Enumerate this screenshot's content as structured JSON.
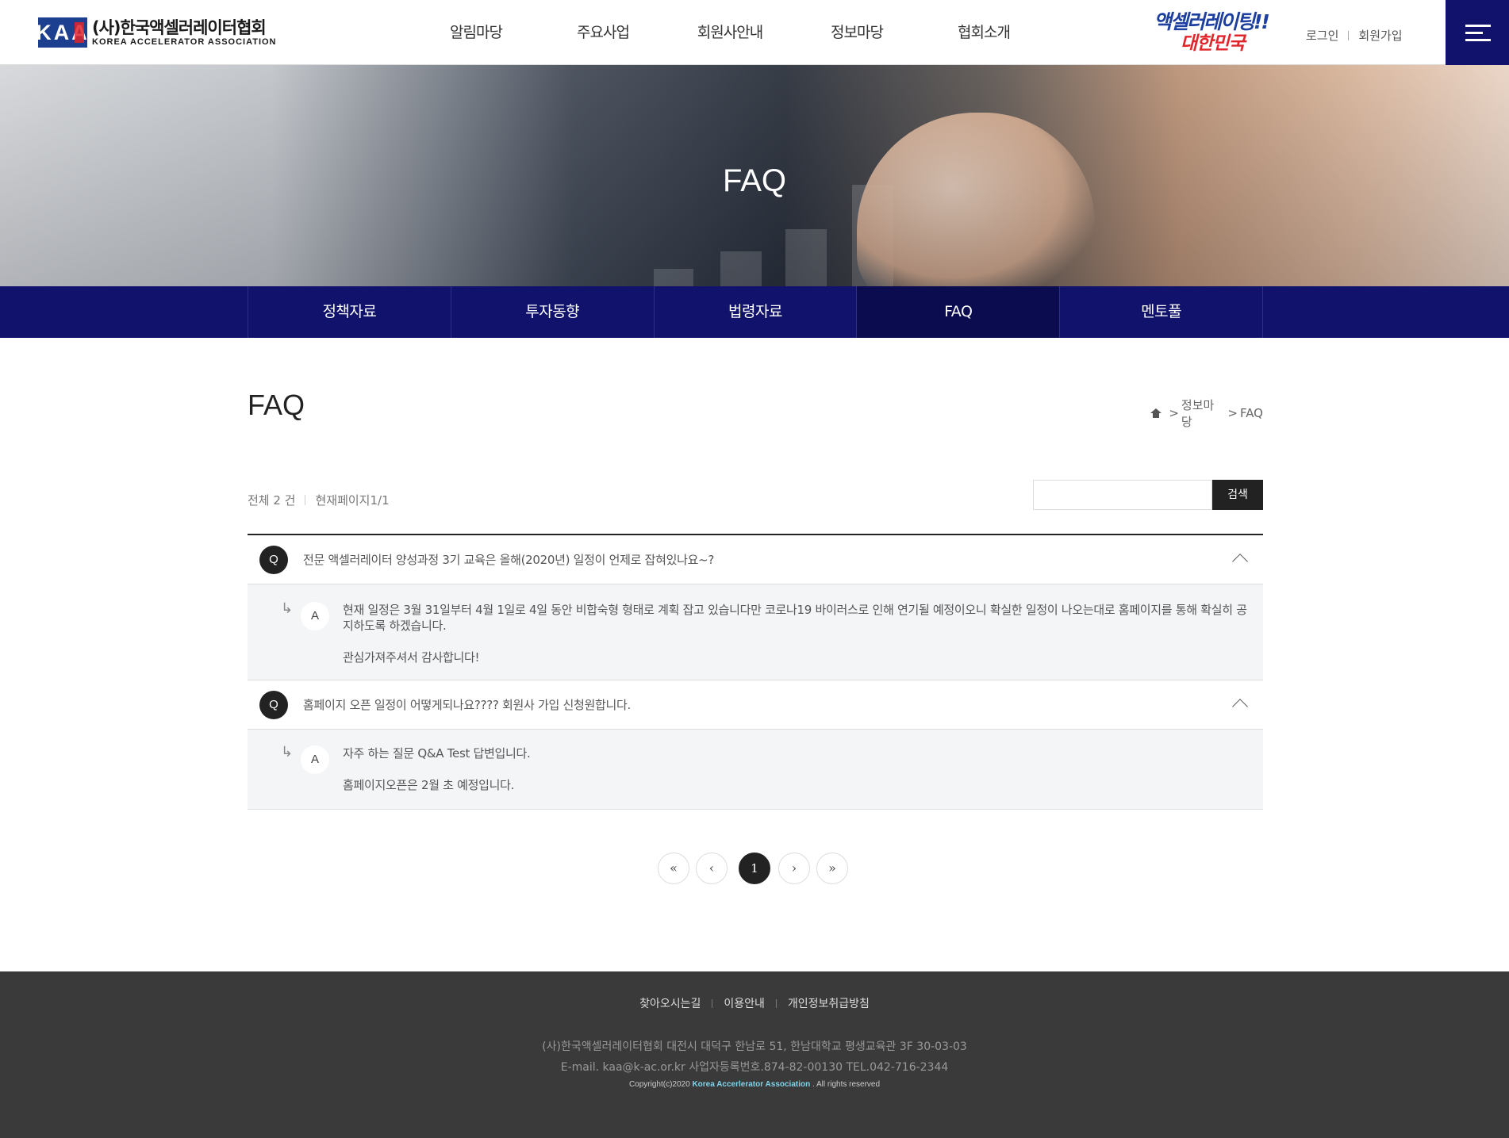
{
  "header": {
    "logo_mark": "KAA",
    "logo_ko": "(사)한국액셀러레이터협회",
    "logo_en": "KOREA ACCELERATOR ASSOCIATION",
    "nav": [
      "알림마당",
      "주요사업",
      "회원사안내",
      "정보마당",
      "협회소개"
    ],
    "slogan_line1": "액셀러레이팅!!",
    "slogan_line2": "대한민국",
    "login": "로그인",
    "join": "회원가입",
    "menu_icon": "hamburger-icon"
  },
  "hero": {
    "title": "FAQ"
  },
  "subnav": {
    "items": [
      "정책자료",
      "투자동향",
      "법령자료",
      "FAQ",
      "멘토풀"
    ],
    "active": "FAQ"
  },
  "content": {
    "title": "FAQ",
    "breadcrumb": [
      "정보마당",
      "FAQ"
    ],
    "total": "전체 2 건",
    "current_page": "현재페이지1/1",
    "search_placeholder": "",
    "search_button": "검색"
  },
  "faqs": [
    {
      "q_badge": "Q",
      "question": "전문 액셀러레이터 양성과정 3기 교육은 올해(2020년) 일정이 언제로 잡혀있나요~?",
      "a_badge": "A",
      "answer": [
        "현재  일정은 3월 31일부터 4월 1일로 4일 동안 비합숙형 형태로 계획 잡고 있습니다만 코로나19 바이러스로 인해 연기될 예정이오니 확실한 일정이 나오는대로 홈페이지를 통해 확실히 공지하도록 하겠습니다.",
        "관심가져주셔서 감사합니다!"
      ]
    },
    {
      "q_badge": "Q",
      "question": "홈페이지 오픈 일정이 어떻게되나요???? 회원사 가입 신청원합니다.",
      "a_badge": "A",
      "answer": [
        "자주 하는 질문 Q&A Test 답변입니다.",
        "홈페이지오픈은 2월 초 예정입니다."
      ]
    }
  ],
  "pagination": {
    "first": "«",
    "prev": "‹",
    "current": "1",
    "next": "›",
    "last": "»"
  },
  "footer": {
    "links": [
      "찾아오시는길",
      "이용안내",
      "개인정보취급방침"
    ],
    "address_line1": "(사)한국액셀러레이터협회 대전시 대덕구 한남로 51, 한남대학교 평생교육관 3F 30-03-03",
    "address_line2": "E-mail. kaa@k-ac.or.kr 사업자등록번호.874-82-00130 TEL.042-716-2344",
    "copyright_prefix": "Copyright(c)2020",
    "copyright_org": "Korea  Accerlerator Association",
    "copyright_suffix": ". All rights reserved"
  },
  "colors": {
    "navy": "#10126b",
    "navy_active": "#0a0c4f",
    "footer_bg": "#3a3a3a",
    "accent_red": "#e0252b",
    "accent_blue": "#1d3f9f"
  }
}
